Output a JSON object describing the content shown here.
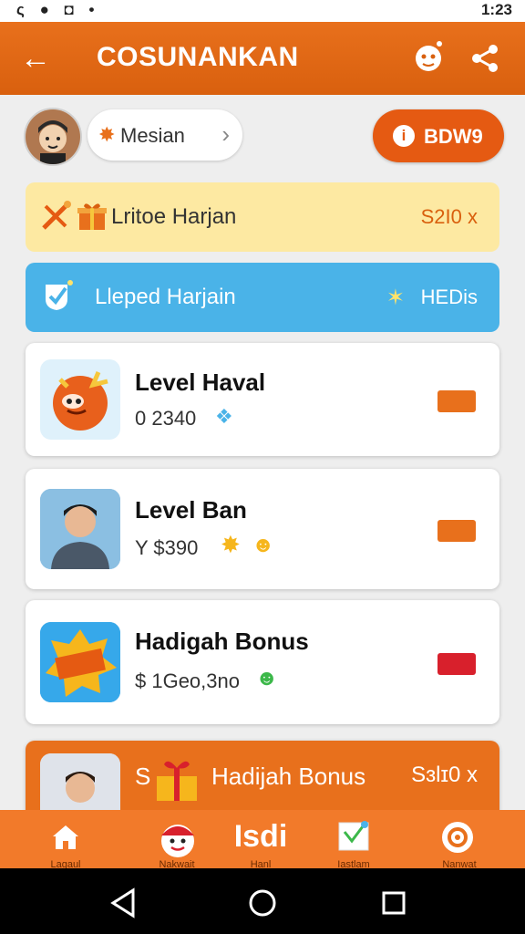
{
  "status": {
    "left": "ς ● ◘ •",
    "right": "1:23"
  },
  "appbar": {
    "title": "COSUNANKAN",
    "back_icon": "back-arrow-icon",
    "mascot_icon": "mascot-icon",
    "share_icon": "share-icon"
  },
  "user": {
    "pill_label": "Mesian",
    "button_label": "BDW9",
    "button_icon_text": "i"
  },
  "banners": [
    {
      "label": "Lritoe Harjan",
      "right": "S2I0 x"
    },
    {
      "label": "Lleped Harjain",
      "right": "HEDis"
    }
  ],
  "cards": [
    {
      "title": "Level Haval",
      "sub": "0 2340"
    },
    {
      "title": "Level Ban",
      "sub": "Y $390"
    },
    {
      "title": "Hadigah Bonus",
      "sub": "$ 1Geo,3no"
    }
  ],
  "promo": {
    "pre": "S",
    "label": "Hadijah Bonus",
    "right": "Sɜlɪ0 x"
  },
  "bottom_nav": {
    "items": [
      {
        "label": "Lagaul"
      },
      {
        "label": "Nakwait"
      },
      {
        "label": "Hanl",
        "big": "Isdi"
      },
      {
        "label": "Iastlam"
      },
      {
        "label": "Nanwat"
      }
    ]
  },
  "colors": {
    "brand_orange": "#e8701c",
    "accent_blue": "#4ab3e8",
    "banner_yellow": "#fde9a2"
  }
}
